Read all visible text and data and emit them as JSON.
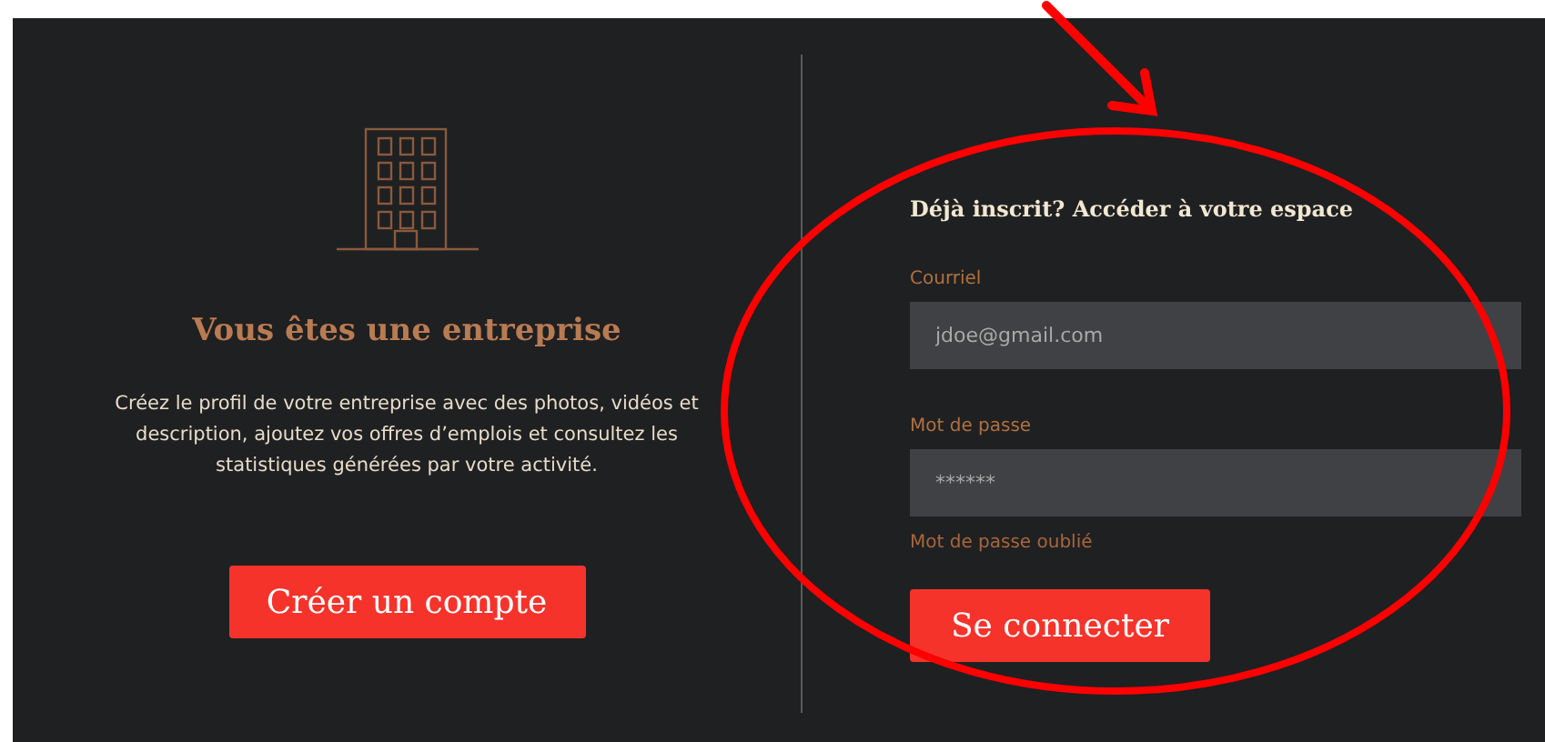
{
  "company": {
    "title": "Vous êtes une entreprise",
    "description": "Créez le profil de votre entreprise avec des photos, vidéos et description, ajoutez vos offres d’emplois et consultez les statistiques générées par votre activité.",
    "button": "Créer un compte"
  },
  "login": {
    "heading": "Déjà inscrit? Accéder à votre espace",
    "fields": [
      {
        "label": "Courriel",
        "placeholder": "jdoe@gmail.com"
      },
      {
        "label": "Mot de passe",
        "placeholder": "******"
      }
    ],
    "forgot_link": "Mot de passe oublié",
    "button": "Se connecter"
  }
}
